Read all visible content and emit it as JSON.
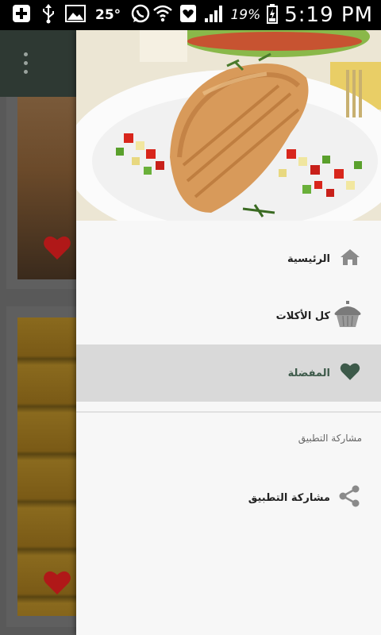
{
  "status_bar": {
    "temperature": "25°",
    "battery": "19%",
    "time": "5:19 PM",
    "icons": [
      "add-icon",
      "usb-icon",
      "image-icon",
      "whatsapp-icon",
      "wifi-icon",
      "notification-icon",
      "signal-icon",
      "battery-icon"
    ]
  },
  "background_app": {
    "toolbar_icon": "overflow-menu-icon",
    "card_icon": "heart-icon"
  },
  "drawer": {
    "header_image": "grilled-chicken-with-vegetables",
    "items": [
      {
        "label": "الرئيسية",
        "icon": "home-icon"
      },
      {
        "label": "كل الأكلات",
        "icon": "cupcake-icon"
      },
      {
        "label": "المفضلة",
        "icon": "heart-icon",
        "selected": true
      }
    ],
    "section_header": "مشاركة التطبيق",
    "share_item": {
      "label": "مشاركة التطبيق",
      "icon": "share-icon"
    }
  },
  "colors": {
    "toolbar": "#2e3933",
    "selected_item_bg": "#d9d9d9",
    "accent": "#3d5a4a",
    "heart_red": "#e02020",
    "icon_gray": "#8a8a8a"
  }
}
